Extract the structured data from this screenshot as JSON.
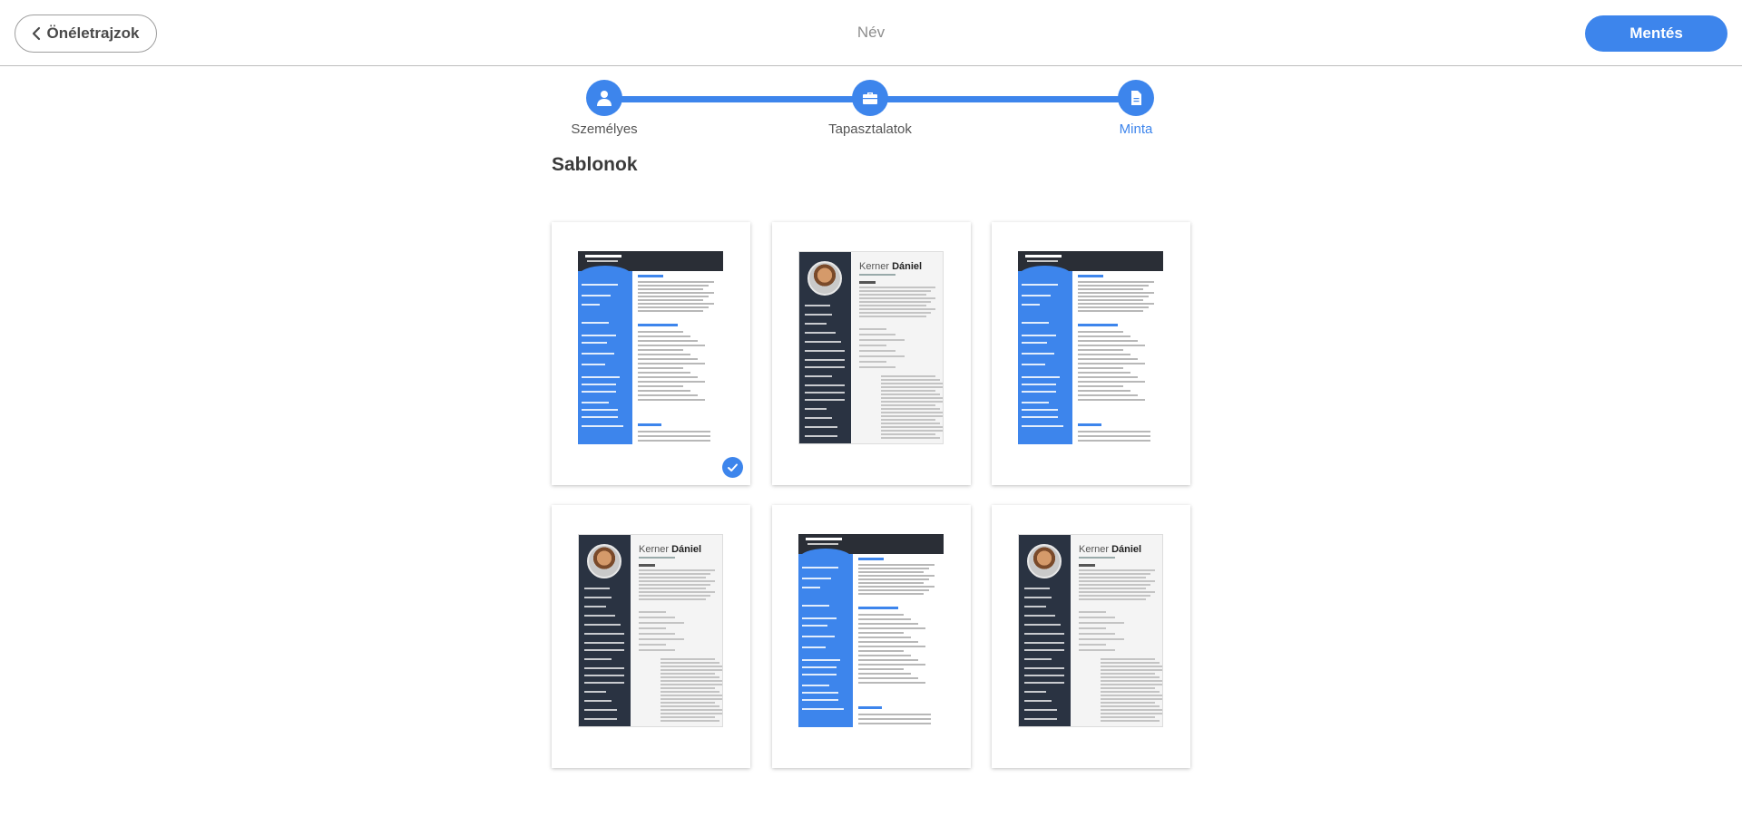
{
  "header": {
    "back_label": "Önéletrajzok",
    "doc_name": "Név",
    "save_label": "Mentés"
  },
  "stepper": {
    "steps": [
      {
        "label": "Személyes",
        "icon": "person-icon",
        "active": false
      },
      {
        "label": "Tapasztalatok",
        "icon": "briefcase-icon",
        "active": false
      },
      {
        "label": "Minta",
        "icon": "document-icon",
        "active": true
      }
    ]
  },
  "section_title": "Sablonok",
  "templates": [
    {
      "style": "blue",
      "selected": true
    },
    {
      "style": "dark",
      "selected": false
    },
    {
      "style": "blue",
      "selected": false
    },
    {
      "style": "dark",
      "selected": false
    },
    {
      "style": "blue",
      "selected": false
    },
    {
      "style": "dark",
      "selected": false
    }
  ],
  "thumbnail_name": {
    "first": "Kerner",
    "last": "Dániel"
  },
  "colors": {
    "accent": "#3d85ec",
    "dark_sidebar": "#2a3342",
    "header_dark": "#2a2e36"
  }
}
